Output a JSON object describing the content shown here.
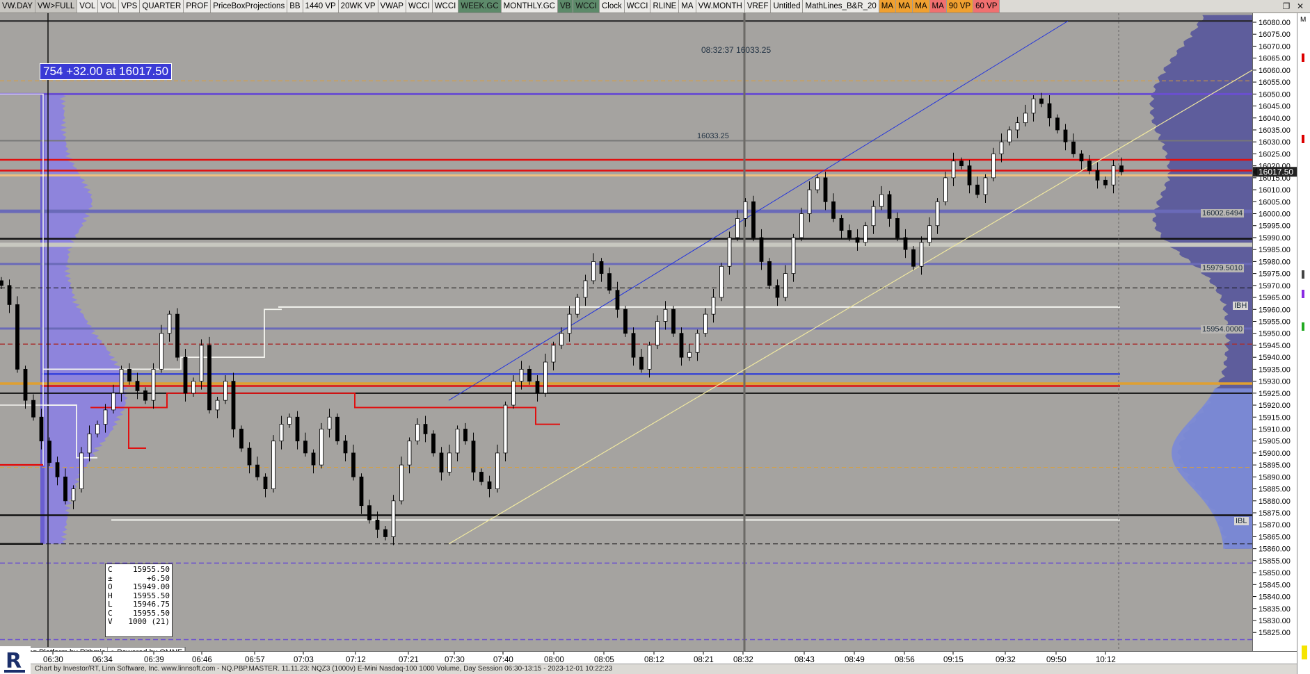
{
  "toolbar": {
    "tabs": [
      {
        "label": "VW.DAY",
        "color": "#c8c6c1"
      },
      {
        "label": "VW>FULL",
        "color": "#c8c6c1"
      },
      {
        "label": "VOL",
        "color": "#ecebe8"
      },
      {
        "label": "VOL",
        "color": "#ecebe8"
      },
      {
        "label": "VPS",
        "color": "#ecebe8"
      },
      {
        "label": "QUARTER",
        "color": "#ecebe8"
      },
      {
        "label": "PROF",
        "color": "#ecebe8"
      },
      {
        "label": "PriceBoxProjections",
        "color": "#ecebe8"
      },
      {
        "label": "BB",
        "color": "#ecebe8"
      },
      {
        "label": "1440 VP",
        "color": "#ecebe8"
      },
      {
        "label": "20WK VP",
        "color": "#ecebe8"
      },
      {
        "label": "VWAP",
        "color": "#ecebe8"
      },
      {
        "label": "WCCI",
        "color": "#ecebe8"
      },
      {
        "label": "WCCI",
        "color": "#ecebe8"
      },
      {
        "label": "WEEK.GC",
        "color": "#5d8a6a"
      },
      {
        "label": "MONTHLY.GC",
        "color": "#ecebe8"
      },
      {
        "label": "VB",
        "color": "#5d8a6a"
      },
      {
        "label": "WCCI",
        "color": "#5d8a6a"
      },
      {
        "label": "Clock",
        "color": "#ecebe8"
      },
      {
        "label": "WCCI",
        "color": "#ecebe8"
      },
      {
        "label": "RLINE",
        "color": "#ecebe8"
      },
      {
        "label": "MA",
        "color": "#ecebe8"
      },
      {
        "label": "VW.MONTH",
        "color": "#ecebe8"
      },
      {
        "label": "VREF",
        "color": "#ecebe8"
      },
      {
        "label": "Untitled",
        "color": "#ecebe8"
      },
      {
        "label": "MathLines_B&R_20",
        "color": "#ecebe8"
      },
      {
        "label": "MA",
        "color": "#f0a030"
      },
      {
        "label": "MA",
        "color": "#f0a030"
      },
      {
        "label": "MA",
        "color": "#f0a030"
      },
      {
        "label": "MA",
        "color": "#f07070"
      },
      {
        "label": "90 VP",
        "color": "#f0a030"
      },
      {
        "label": "60 VP",
        "color": "#f07070"
      }
    ]
  },
  "quote_badge": "754  +32.00 at 16017.50",
  "crosshair": {
    "time": "08:32:37",
    "price": "16033.25",
    "level_label": "16033.25"
  },
  "levels": {
    "poc_labels": [
      "16002.6494",
      "15979.5010",
      "15954.0000"
    ],
    "ibh": "IBH",
    "ibl": "IBL",
    "last_price": "16017.50"
  },
  "ohlc": {
    "rows": [
      {
        "k": "C",
        "v": "15955.50"
      },
      {
        "k": "±",
        "v": "+6.50"
      },
      {
        "k": "O",
        "v": "15949.00"
      },
      {
        "k": "H",
        "v": "15955.50"
      },
      {
        "k": "L",
        "v": "15946.75"
      },
      {
        "k": "C",
        "v": "15955.50"
      },
      {
        "k": "V",
        "v": "1000 (21)"
      }
    ]
  },
  "rithmic": {
    "a": "Trading Platform by Rithmic",
    "b": "Powered by OMNE"
  },
  "price_axis": [
    "16080.00",
    "16075.00",
    "16070.00",
    "16065.00",
    "16060.00",
    "16055.00",
    "16050.00",
    "16045.00",
    "16040.00",
    "16035.00",
    "16030.00",
    "16025.00",
    "16020.00",
    "16015.00",
    "16010.00",
    "16005.00",
    "16000.00",
    "15995.00",
    "15990.00",
    "15985.00",
    "15980.00",
    "15975.00",
    "15970.00",
    "15965.00",
    "15960.00",
    "15955.00",
    "15950.00",
    "15945.00",
    "15940.00",
    "15935.00",
    "15930.00",
    "15925.00",
    "15920.00",
    "15915.00",
    "15910.00",
    "15905.00",
    "15900.00",
    "15895.00",
    "15890.00",
    "15885.00",
    "15880.00",
    "15875.00",
    "15870.00",
    "15865.00",
    "15860.00",
    "15855.00",
    "15850.00",
    "15845.00",
    "15840.00",
    "15835.00",
    "15830.00",
    "15825.00"
  ],
  "time_axis": [
    "06:30",
    "06:34",
    "06:39",
    "06:46",
    "06:57",
    "07:03",
    "07:12",
    "07:21",
    "07:30",
    "07:40",
    "08:00",
    "08:05",
    "08:12",
    "08:21",
    "08:32",
    "08:43",
    "08:49",
    "08:56",
    "09:15",
    "09:32",
    "09:50",
    "10:12"
  ],
  "status": "Chart by Investor/RT, Linn Software, Inc. www.linnsoft.com - NQ.PBP.MASTER.   11.11.23: NQZ3 (1000v) E-Mini Nasdaq-100 1000 Volume, Day Session 06:30-13:15 - 2023-12-01 10:22:23",
  "right_strip": {
    "m": "M"
  },
  "chart_data": {
    "type": "candlestick",
    "ylim": [
      15820,
      16085
    ],
    "closes": [
      15970,
      15962,
      15935,
      15922,
      15915,
      15905,
      15896,
      15890,
      15880,
      15885,
      15900,
      15908,
      15912,
      15918,
      15925,
      15935,
      15930,
      15926,
      15922,
      15935,
      15950,
      15958,
      15940,
      15925,
      15930,
      15945,
      15918,
      15922,
      15930,
      15910,
      15902,
      15895,
      15890,
      15885,
      15905,
      15912,
      15915,
      15905,
      15900,
      15895,
      15910,
      15915,
      15905,
      15900,
      15890,
      15878,
      15872,
      15868,
      15865,
      15880,
      15895,
      15905,
      15912,
      15908,
      15900,
      15892,
      15900,
      15910,
      15905,
      15892,
      15888,
      15885,
      15900,
      15920,
      15930,
      15935,
      15930,
      15925,
      15938,
      15945,
      15950,
      15958,
      15965,
      15972,
      15980,
      15975,
      15968,
      15960,
      15950,
      15940,
      15935,
      15945,
      15955,
      15960,
      15950,
      15940,
      15942,
      15950,
      15958,
      15965,
      15978,
      15990,
      15998,
      16005,
      15990,
      15980,
      15970,
      15965,
      15975,
      15990,
      16000,
      16010,
      16015,
      16005,
      15998,
      15993,
      15990,
      15988,
      15995,
      16003,
      16008,
      15998,
      15990,
      15985,
      15978,
      15988,
      15995,
      16005,
      16015,
      16022,
      16020,
      16012,
      16008,
      16015,
      16025,
      16030,
      16035,
      16038,
      16042,
      16048,
      16046,
      16040,
      16035,
      16030,
      16025,
      16022,
      16018,
      16014,
      16012,
      16020,
      16017.5
    ],
    "last": 16017.5
  }
}
